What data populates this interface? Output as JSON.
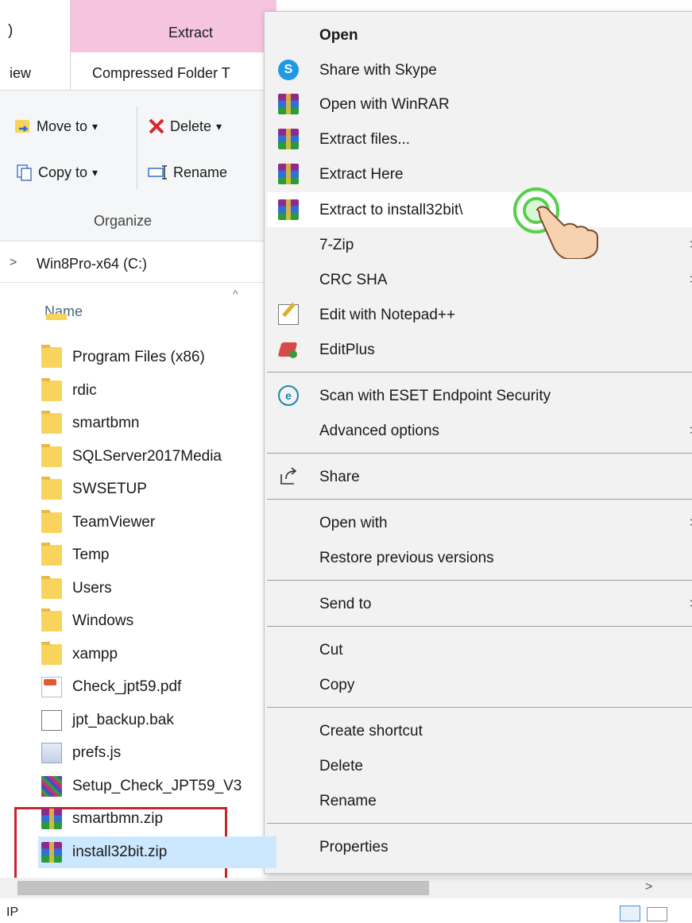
{
  "ribbon": {
    "tab_partial": ")",
    "extract_tab": "Extract",
    "view_tab_partial": "iew",
    "compressed_tab": "Compressed Folder T",
    "move_to": "Move to",
    "copy_to": "Copy to",
    "delete": "Delete",
    "rename": "Rename",
    "organize_group": "Organize",
    "dropdown_arrow": "▾"
  },
  "address": {
    "chevron": ">",
    "path": "Win8Pro-x64 (C:)"
  },
  "file_list": {
    "column_name": "Name",
    "sort_caret": "^",
    "items": [
      {
        "name": "Program Files (x86)",
        "icon": "folder-icon"
      },
      {
        "name": "rdic",
        "icon": "folder-icon"
      },
      {
        "name": "smartbmn",
        "icon": "folder-icon"
      },
      {
        "name": "SQLServer2017Media",
        "icon": "folder-icon"
      },
      {
        "name": "SWSETUP",
        "icon": "folder-icon"
      },
      {
        "name": "TeamViewer",
        "icon": "folder-icon"
      },
      {
        "name": "Temp",
        "icon": "folder-icon"
      },
      {
        "name": "Users",
        "icon": "folder-icon"
      },
      {
        "name": "Windows",
        "icon": "folder-icon"
      },
      {
        "name": "xampp",
        "icon": "folder-icon"
      },
      {
        "name": "Check_jpt59.pdf",
        "icon": "pdf-file-icon"
      },
      {
        "name": "jpt_backup.bak",
        "icon": "blank-file-icon"
      },
      {
        "name": "prefs.js",
        "icon": "script-file-icon"
      },
      {
        "name": "Setup_Check_JPT59_V3",
        "icon": "setup-file-icon"
      },
      {
        "name": "smartbmn.zip",
        "icon": "winrar-archive-icon"
      },
      {
        "name": "install32bit.zip",
        "icon": "winrar-archive-icon"
      }
    ]
  },
  "context_menu": {
    "open": "Open",
    "share_with_skype": "Share with Skype",
    "skype_glyph": "S",
    "open_with_winrar": "Open with WinRAR",
    "extract_files": "Extract files...",
    "extract_here": "Extract Here",
    "extract_to": "Extract to install32bit\\",
    "seven_zip": "7-Zip",
    "crc_sha": "CRC SHA",
    "edit_notepadpp": "Edit with Notepad++",
    "editplus": "EditPlus",
    "scan_eset": "Scan with ESET Endpoint Security",
    "eset_glyph": "e",
    "advanced_options": "Advanced options",
    "share": "Share",
    "open_with": "Open with",
    "restore_previous": "Restore previous versions",
    "send_to": "Send to",
    "cut": "Cut",
    "copy": "Copy",
    "create_shortcut": "Create shortcut",
    "delete": "Delete",
    "rename": "Rename",
    "properties": "Properties",
    "submenu_arrow": ">"
  },
  "status": {
    "text": "IP",
    "scroll_right": ">"
  },
  "colors": {
    "extract_tab_bg": "#f5c5e0",
    "selection_bg": "#cce8ff",
    "highlight_border": "#c8262d",
    "tap_ring": "#56d04a"
  }
}
